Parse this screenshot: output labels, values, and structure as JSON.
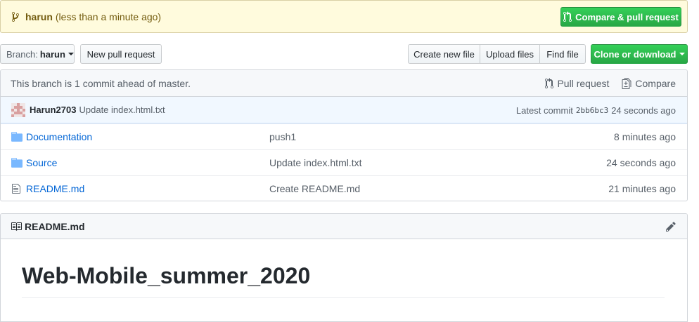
{
  "banner": {
    "branch_name": "harun",
    "time_text": "(less than a minute ago)",
    "compare_button": "Compare & pull request"
  },
  "toolbar": {
    "branch_label": "Branch:",
    "branch_value": "harun",
    "new_pr": "New pull request",
    "create_file": "Create new file",
    "upload_files": "Upload files",
    "find_file": "Find file",
    "clone": "Clone or download"
  },
  "branch_info": {
    "text": "This branch is 1 commit ahead of master.",
    "pull_request": "Pull request",
    "compare": "Compare"
  },
  "commit": {
    "author": "Harun2703",
    "message": "Update index.html.txt",
    "latest_label": "Latest commit",
    "sha": "2bb6bc3",
    "age": "24 seconds ago"
  },
  "files": [
    {
      "name": "Documentation",
      "type": "folder",
      "message": "push1",
      "age": "8 minutes ago"
    },
    {
      "name": "Source",
      "type": "folder",
      "message": "Update index.html.txt",
      "age": "24 seconds ago"
    },
    {
      "name": "README.md",
      "type": "file",
      "message": "Create README.md",
      "age": "21 minutes ago"
    }
  ],
  "readme": {
    "title": "README.md",
    "heading": "Web-Mobile_summer_2020"
  },
  "colors": {
    "primary_green": "#28a745",
    "link_blue": "#0366d6",
    "banner_bg": "#fffbdd"
  }
}
